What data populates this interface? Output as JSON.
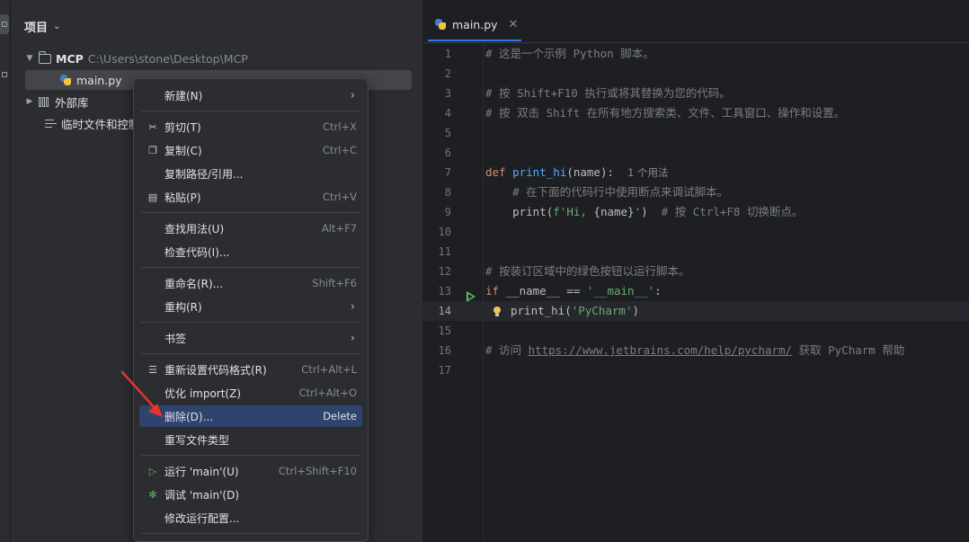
{
  "project_panel": {
    "title": "项目",
    "tree": [
      {
        "name": "MCP",
        "path": "C:\\Users\\stone\\Desktop\\MCP"
      },
      {
        "name": "main.py"
      },
      {
        "name": "外部库"
      },
      {
        "name": "临时文件和控制"
      }
    ]
  },
  "editor": {
    "tab_title": "main.py",
    "line_numbers": [
      "1",
      "2",
      "3",
      "4",
      "5",
      "6",
      "7",
      "8",
      "9",
      "10",
      "11",
      "12",
      "13",
      "14",
      "15",
      "16",
      "17"
    ],
    "code": {
      "l1": "# 这是一个示例 Python 脚本。",
      "l3": "# 按 Shift+F10 执行或将其替换为您的代码。",
      "l4": "# 按 双击 Shift 在所有地方搜索类、文件、工具窗口、操作和设置。",
      "l7_def": "def ",
      "l7_fn": "print_hi",
      "l7_rest": "(name):",
      "l7_hint": "1 个用法",
      "l8": "    # 在下面的代码行中使用断点来调试脚本。",
      "l9_a": "    print(",
      "l9_str1": "f'Hi, ",
      "l9_mid": "{name}",
      "l9_str2": "'",
      "l9_b": ")  ",
      "l9_com": "# 按 Ctrl+F8 切换断点。",
      "l12": "# 按装订区域中的绿色按钮以运行脚本。",
      "l13_if": "if ",
      "l13_a": "__name__ == ",
      "l13_str": "'__main__'",
      "l13_b": ":",
      "l14_a": "print_hi(",
      "l14_str": "'PyCharm'",
      "l14_b": ")",
      "l16_a": "# 访问 ",
      "l16_link": "https://www.jetbrains.com/help/pycharm/",
      "l16_b": " 获取 PyCharm 帮助"
    }
  },
  "context_menu": {
    "items": [
      {
        "label": "新建(N)",
        "shortcut": "",
        "submenu": true
      },
      {
        "label": "剪切(T)",
        "shortcut": "Ctrl+X",
        "icon": "scissors-icon"
      },
      {
        "label": "复制(C)",
        "shortcut": "Ctrl+C",
        "icon": "copy-icon"
      },
      {
        "label": "复制路径/引用...",
        "shortcut": ""
      },
      {
        "label": "粘贴(P)",
        "shortcut": "Ctrl+V",
        "icon": "paste-icon"
      },
      {
        "label": "查找用法(U)",
        "shortcut": "Alt+F7"
      },
      {
        "label": "检查代码(I)...",
        "shortcut": ""
      },
      {
        "label": "重命名(R)...",
        "shortcut": "Shift+F6"
      },
      {
        "label": "重构(R)",
        "shortcut": "",
        "submenu": true
      },
      {
        "label": "书签",
        "shortcut": "",
        "submenu": true
      },
      {
        "label": "重新设置代码格式(R)",
        "shortcut": "Ctrl+Alt+L",
        "icon": "reformat-icon"
      },
      {
        "label": "优化 import(Z)",
        "shortcut": "Ctrl+Alt+O"
      },
      {
        "label": "删除(D)...",
        "shortcut": "Delete",
        "highlighted": true
      },
      {
        "label": "重写文件类型",
        "shortcut": ""
      },
      {
        "label": "运行 'main'(U)",
        "shortcut": "Ctrl+Shift+F10",
        "icon": "run-icon"
      },
      {
        "label": "调试 'main'(D)",
        "shortcut": "",
        "icon": "debug-icon"
      },
      {
        "label": "修改运行配置...",
        "shortcut": ""
      }
    ]
  },
  "colors": {
    "accent": "#3574f0",
    "menu_highlight": "#2e436e",
    "annotation_arrow": "#e8322c"
  }
}
